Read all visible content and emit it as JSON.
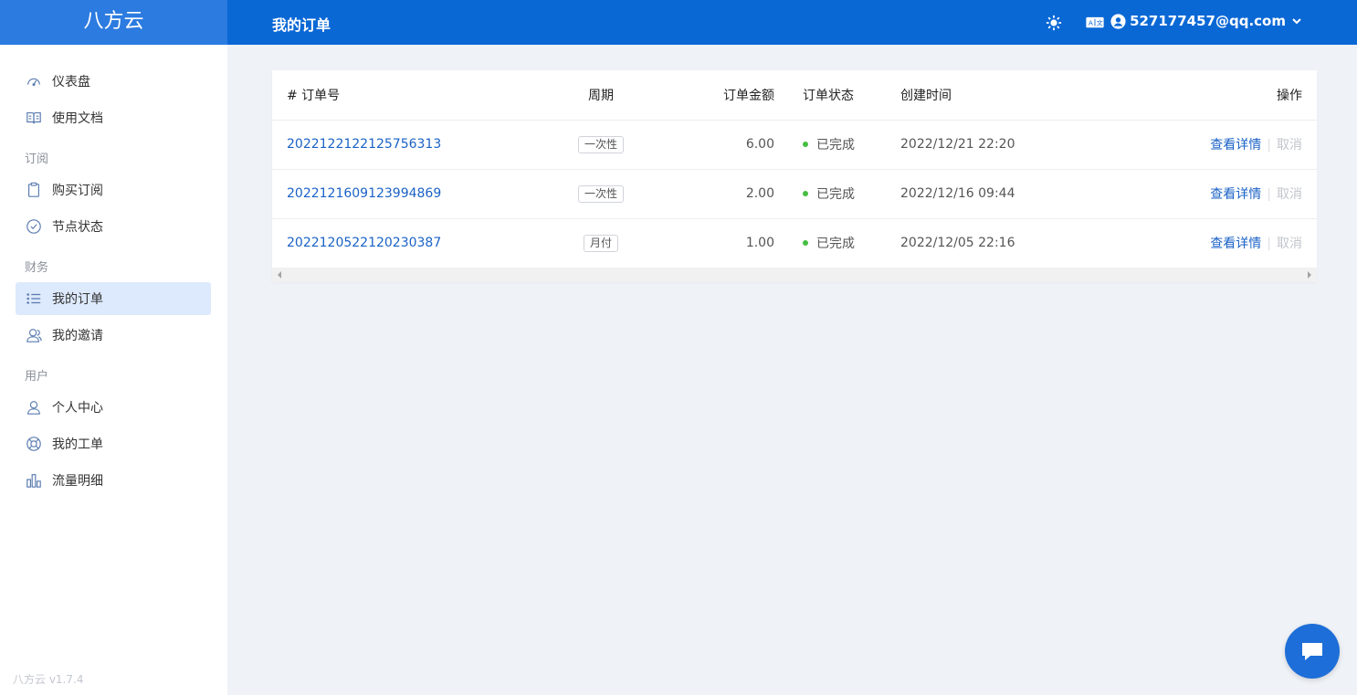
{
  "brand": "八方云",
  "version": "八方云 v1.7.4",
  "header": {
    "title": "我的订单",
    "user_email": "527177457@qq.com"
  },
  "sidebar": {
    "items_top": [
      {
        "label": "仪表盘",
        "icon": "dashboard-icon"
      },
      {
        "label": "使用文档",
        "icon": "book-icon"
      }
    ],
    "groups": [
      {
        "title": "订阅",
        "items": [
          {
            "label": "购买订阅",
            "icon": "clipboard-icon"
          },
          {
            "label": "节点状态",
            "icon": "check-circle-icon"
          }
        ]
      },
      {
        "title": "财务",
        "items": [
          {
            "label": "我的订单",
            "icon": "list-icon",
            "active": true
          },
          {
            "label": "我的邀请",
            "icon": "users-icon"
          }
        ]
      },
      {
        "title": "用户",
        "items": [
          {
            "label": "个人中心",
            "icon": "user-icon"
          },
          {
            "label": "我的工单",
            "icon": "lifebuoy-icon"
          },
          {
            "label": "流量明细",
            "icon": "bar-chart-icon"
          }
        ]
      }
    ]
  },
  "table": {
    "headers": {
      "order_no": "# 订单号",
      "period": "周期",
      "amount": "订单金额",
      "status": "订单状态",
      "created": "创建时间",
      "actions": "操作"
    },
    "rows": [
      {
        "order_no": "2022122122125756313",
        "period": "一次性",
        "amount": "6.00",
        "status": "已完成",
        "created": "2022/12/21 22:20",
        "view": "查看详情",
        "cancel": "取消"
      },
      {
        "order_no": "2022121609123994869",
        "period": "一次性",
        "amount": "2.00",
        "status": "已完成",
        "created": "2022/12/16 09:44",
        "view": "查看详情",
        "cancel": "取消"
      },
      {
        "order_no": "2022120522120230387",
        "period": "月付",
        "amount": "1.00",
        "status": "已完成",
        "created": "2022/12/05 22:16",
        "view": "查看详情",
        "cancel": "取消"
      }
    ]
  },
  "colors": {
    "header_bg": "#0a68d5",
    "brand_bg": "#2c7be0",
    "link": "#1a62c6",
    "status_ok": "#46be43"
  }
}
